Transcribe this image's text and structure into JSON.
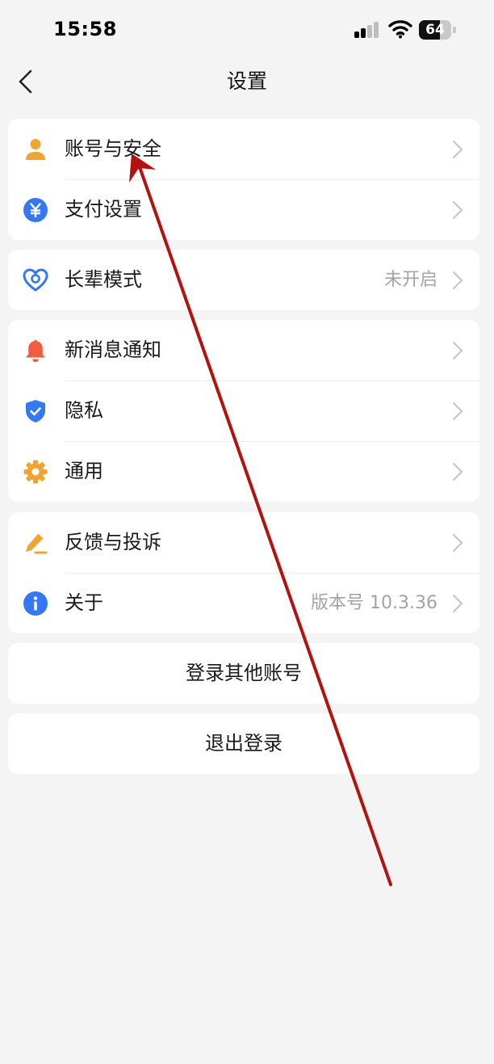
{
  "status_bar": {
    "time": "15:58",
    "battery_level": 64,
    "battery_label": "64"
  },
  "header": {
    "title": "设置"
  },
  "groups": [
    {
      "items": [
        {
          "label": "账号与安全",
          "icon": "user-icon",
          "value": ""
        },
        {
          "label": "支付设置",
          "icon": "yuan-icon",
          "value": ""
        }
      ]
    },
    {
      "items": [
        {
          "label": "长辈模式",
          "icon": "heart-icon",
          "value": "未开启"
        }
      ]
    },
    {
      "items": [
        {
          "label": "新消息通知",
          "icon": "bell-icon",
          "value": ""
        },
        {
          "label": "隐私",
          "icon": "shield-icon",
          "value": ""
        },
        {
          "label": "通用",
          "icon": "gear-icon",
          "value": ""
        }
      ]
    },
    {
      "items": [
        {
          "label": "反馈与投诉",
          "icon": "pencil-icon",
          "value": ""
        },
        {
          "label": "关于",
          "icon": "info-icon",
          "value": "版本号 10.3.36"
        }
      ]
    }
  ],
  "actions": {
    "switch_account": "登录其他账号",
    "logout": "退出登录"
  },
  "colors": {
    "user_icon": "#f0a432",
    "yuan_icon": "#3478f6",
    "heart_icon": "#3478f6",
    "bell_icon": "#f05d3f",
    "shield_icon": "#3478f6",
    "gear_icon": "#f0a432",
    "pencil_icon": "#f0a432",
    "info_icon": "#3478f6",
    "annotation_arrow": "#b3120f"
  }
}
